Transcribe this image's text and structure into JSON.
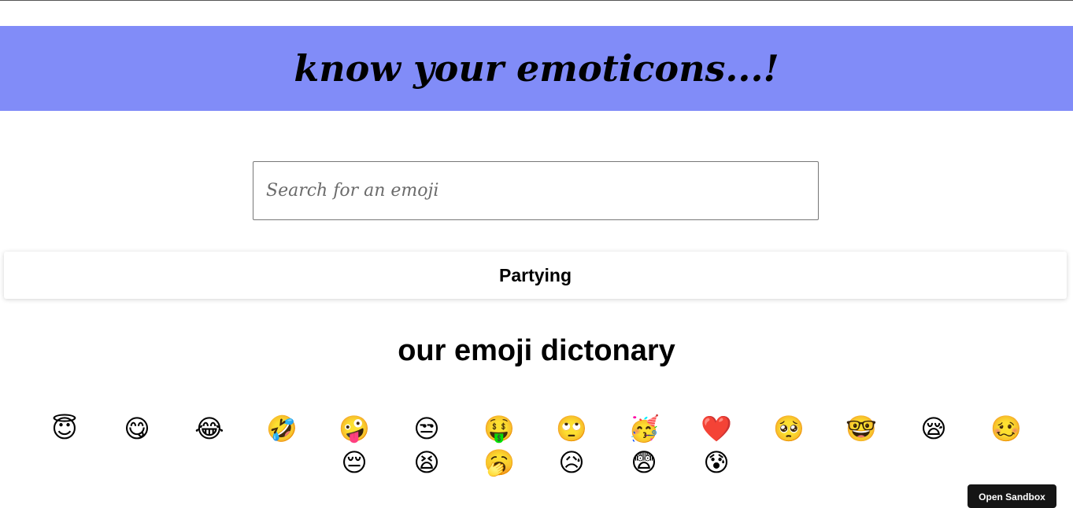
{
  "header": {
    "title": "know your emoticons...!"
  },
  "search": {
    "placeholder": "Search for an emoji",
    "value": ""
  },
  "meaning": {
    "text": "Partying"
  },
  "dictionary": {
    "title": "our emoji dictonary",
    "emojis": [
      {
        "glyph": "😇",
        "name": "smiling-face-with-halo"
      },
      {
        "glyph": "😋",
        "name": "face-savoring-food"
      },
      {
        "glyph": "😂",
        "name": "face-with-tears-of-joy"
      },
      {
        "glyph": "🤣",
        "name": "rolling-on-the-floor-laughing"
      },
      {
        "glyph": "🤪",
        "name": "zany-face"
      },
      {
        "glyph": "😒",
        "name": "unamused-face"
      },
      {
        "glyph": "🤑",
        "name": "money-mouth-face"
      },
      {
        "glyph": "🙄",
        "name": "face-with-rolling-eyes"
      },
      {
        "glyph": "🥳",
        "name": "partying-face"
      },
      {
        "glyph": "❤️",
        "name": "red-heart"
      },
      {
        "glyph": "🥺",
        "name": "pleading-face"
      },
      {
        "glyph": "🤓",
        "name": "nerd-face"
      },
      {
        "glyph": "😪",
        "name": "sleepy-face"
      },
      {
        "glyph": "🥴",
        "name": "woozy-face"
      },
      {
        "glyph": "😔",
        "name": "pensive-face"
      },
      {
        "glyph": "😫",
        "name": "tired-face"
      },
      {
        "glyph": "🥱",
        "name": "yawning-face"
      },
      {
        "glyph": "😥",
        "name": "sad-but-relieved-face"
      },
      {
        "glyph": "😨",
        "name": "fearful-face"
      },
      {
        "glyph": "😰",
        "name": "anxious-face-with-sweat"
      }
    ]
  },
  "sandbox": {
    "label": "Open Sandbox"
  }
}
